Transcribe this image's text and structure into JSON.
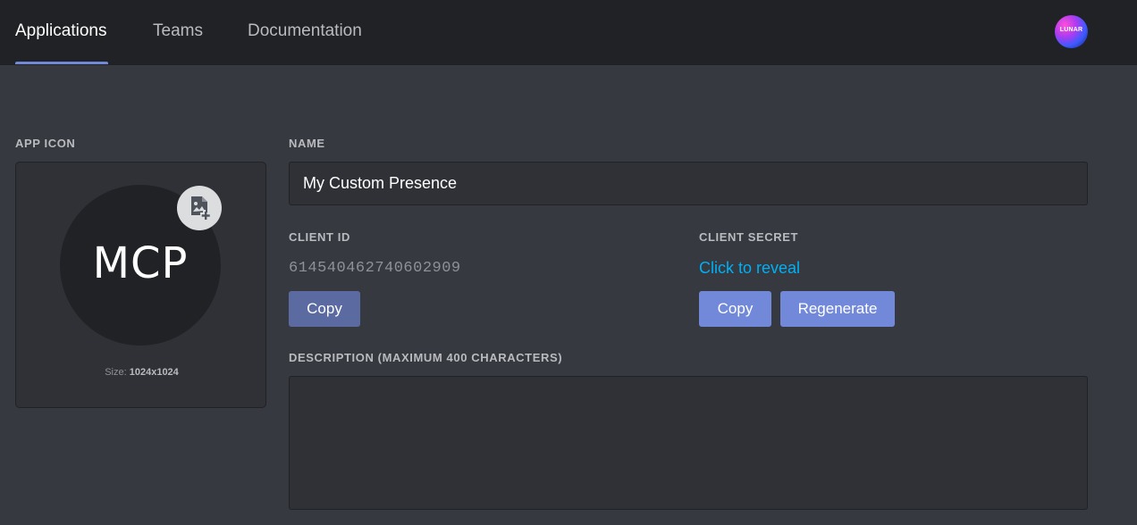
{
  "nav": {
    "tabs": [
      {
        "label": "Applications",
        "active": true
      },
      {
        "label": "Teams",
        "active": false
      },
      {
        "label": "Documentation",
        "active": false
      }
    ],
    "avatar_text": "LUNAR"
  },
  "app_icon": {
    "label": "APP ICON",
    "initials": "MCP",
    "size_prefix": "Size:",
    "size_value": "1024x1024"
  },
  "name": {
    "label": "NAME",
    "value": "My Custom Presence"
  },
  "client_id": {
    "label": "CLIENT ID",
    "value": "614540462740602909",
    "copy_label": "Copy"
  },
  "client_secret": {
    "label": "CLIENT SECRET",
    "reveal_label": "Click to reveal",
    "copy_label": "Copy",
    "regenerate_label": "Regenerate"
  },
  "description": {
    "label": "DESCRIPTION (MAXIMUM 400 CHARACTERS)",
    "value": ""
  },
  "colors": {
    "accent": "#7289da",
    "link": "#00b0f4",
    "background": "#363940",
    "nav_background": "#202225"
  },
  "icons": {
    "upload": "add-image-icon",
    "avatar": "user-avatar"
  }
}
